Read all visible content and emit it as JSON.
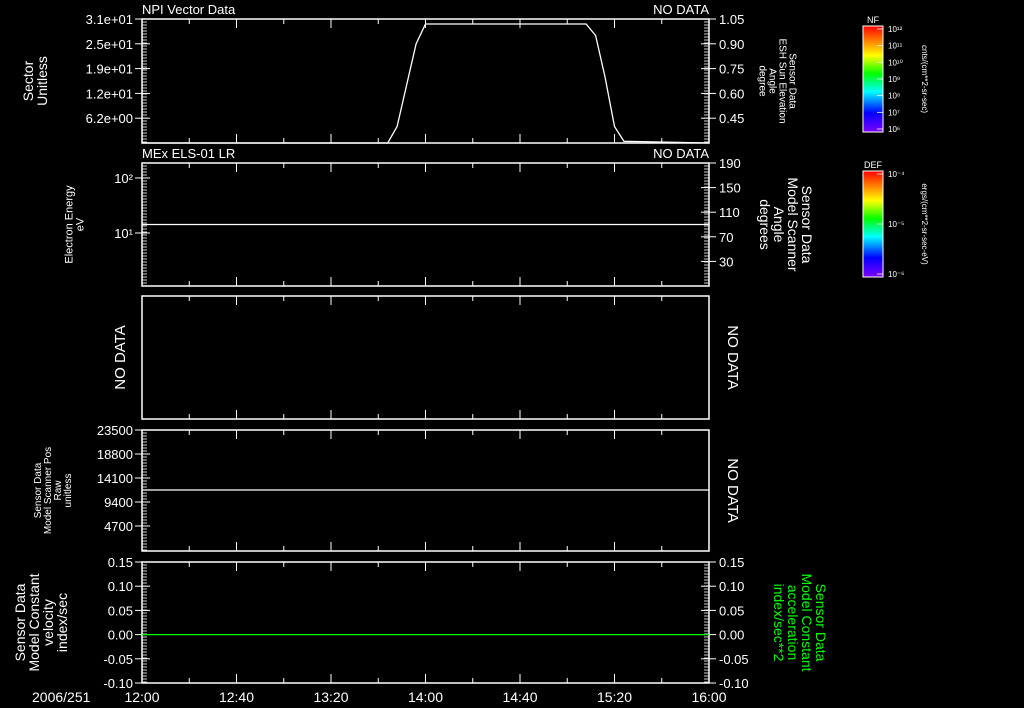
{
  "chart_data": {
    "type": "line",
    "date_label": "2006/251",
    "x_range": [
      "12:00",
      "16:00"
    ],
    "x_ticks": [
      "12:00",
      "12:40",
      "13:20",
      "14:00",
      "14:40",
      "15:20",
      "16:00"
    ],
    "grid": false,
    "panels": [
      {
        "title": "NPI Vector Data",
        "status": "NO DATA",
        "left_label": [
          "Sector",
          "Unitless"
        ],
        "right_label": [
          "Sensor Data",
          "ESH Sun Elevation",
          "Angle",
          "degree"
        ],
        "left_axis": {
          "scale": "linear",
          "ylim": [
            0,
            31
          ],
          "ticks": [
            6.2,
            12.4,
            18.6,
            24.8,
            31
          ],
          "tick_labels": [
            "6.2e+00",
            "1.2e+01",
            "1.9e+01",
            "2.5e+01",
            "3.1e+01"
          ]
        },
        "right_axis": {
          "scale": "linear",
          "ylim": [
            0.3,
            1.05
          ],
          "ticks": [
            0.45,
            0.6,
            0.75,
            0.9,
            1.05
          ],
          "tick_labels": [
            "0.45",
            "0.60",
            "0.75",
            "0.90",
            "1.05"
          ]
        },
        "series": [
          {
            "axis": "right",
            "color": "#ffffff",
            "x": [
              "12:00",
              "13:44",
              "13:48",
              "13:52",
              "13:56",
              "14:00",
              "15:08",
              "15:12",
              "15:16",
              "15:20",
              "15:24",
              "16:00"
            ],
            "y": [
              0.3,
              0.3,
              0.4,
              0.65,
              0.9,
              1.02,
              1.02,
              0.95,
              0.7,
              0.4,
              0.31,
              0.3
            ]
          }
        ]
      },
      {
        "title": "MEx ELS-01 LR",
        "status": "NO DATA",
        "left_label": [
          "Electron Energy",
          "eV"
        ],
        "right_label": [
          "Sensor Data",
          "Model Scanner",
          "Angle",
          "degrees"
        ],
        "left_axis": {
          "scale": "log",
          "ylim": [
            1.09,
            187
          ],
          "ticks": [
            10,
            100
          ],
          "tick_labels": [
            "10¹",
            "10²"
          ]
        },
        "right_axis": {
          "scale": "linear",
          "ylim": [
            -10,
            190
          ],
          "ticks": [
            30,
            70,
            110,
            150,
            190
          ],
          "tick_labels": [
            "30",
            "70",
            "110",
            "150",
            "190"
          ]
        },
        "series": [
          {
            "axis": "right",
            "color": "#ffffff",
            "x": [
              "12:00",
              "16:00"
            ],
            "y": [
              90,
              90
            ]
          }
        ]
      },
      {
        "title": "",
        "status": "",
        "left_nodata": "NO DATA",
        "right_nodata": "NO DATA",
        "left_label": [],
        "right_label": [],
        "series": []
      },
      {
        "title": "",
        "status": "",
        "right_nodata": "NO DATA",
        "left_label": [
          "Sensor Data",
          "Model Scanner Pos",
          "Raw",
          "unitless"
        ],
        "right_label": [],
        "left_axis": {
          "scale": "linear",
          "ylim": [
            -200,
            23500
          ],
          "ticks": [
            4700,
            9400,
            14100,
            18800,
            23500
          ],
          "tick_labels": [
            "4700",
            "9400",
            "14100",
            "18800",
            "23500"
          ]
        },
        "series": [
          {
            "axis": "left",
            "color": "#ffffff",
            "x": [
              "12:00",
              "16:00"
            ],
            "y": [
              11750,
              11750
            ]
          }
        ]
      },
      {
        "title": "",
        "status": "",
        "left_label": [
          "Sensor Data",
          "Model Constant",
          "velocity",
          "index/sec"
        ],
        "right_label": [
          "Sensor Data",
          "Model Constant",
          "acceleration",
          "index/sec**2"
        ],
        "right_label_color": "#00ff00",
        "left_axis": {
          "scale": "linear",
          "ylim": [
            -0.1,
            0.15
          ],
          "ticks": [
            -0.1,
            -0.05,
            0.0,
            0.05,
            0.1,
            0.15
          ],
          "tick_labels": [
            "-0.10",
            "-0.05",
            "0.00",
            "0.05",
            "0.10",
            "0.15"
          ]
        },
        "right_axis": {
          "scale": "linear",
          "ylim": [
            -0.1,
            0.15
          ],
          "ticks": [
            -0.1,
            -0.05,
            0.0,
            0.05,
            0.1,
            0.15
          ],
          "tick_labels": [
            "-0.10",
            "-0.05",
            "0.00",
            "0.05",
            "0.10",
            "0.15"
          ]
        },
        "series": [
          {
            "axis": "left",
            "color": "#00ff00",
            "x": [
              "12:00",
              "16:00"
            ],
            "y": [
              0,
              0
            ]
          }
        ]
      }
    ],
    "colorbars": [
      {
        "title": "NF",
        "unit": "cnts/(cm**2-sr-sec)",
        "tick_labels": [
          "10¹²",
          "10¹¹",
          "10¹⁰",
          "10⁹",
          "10⁸",
          "10⁷",
          "10⁶"
        ]
      },
      {
        "title": "DEF",
        "unit": "ergs/(cm**2-sr-sec-eV)",
        "tick_labels": [
          "10⁻⁴",
          "10⁻⁵",
          "10⁻⁶"
        ]
      }
    ]
  }
}
